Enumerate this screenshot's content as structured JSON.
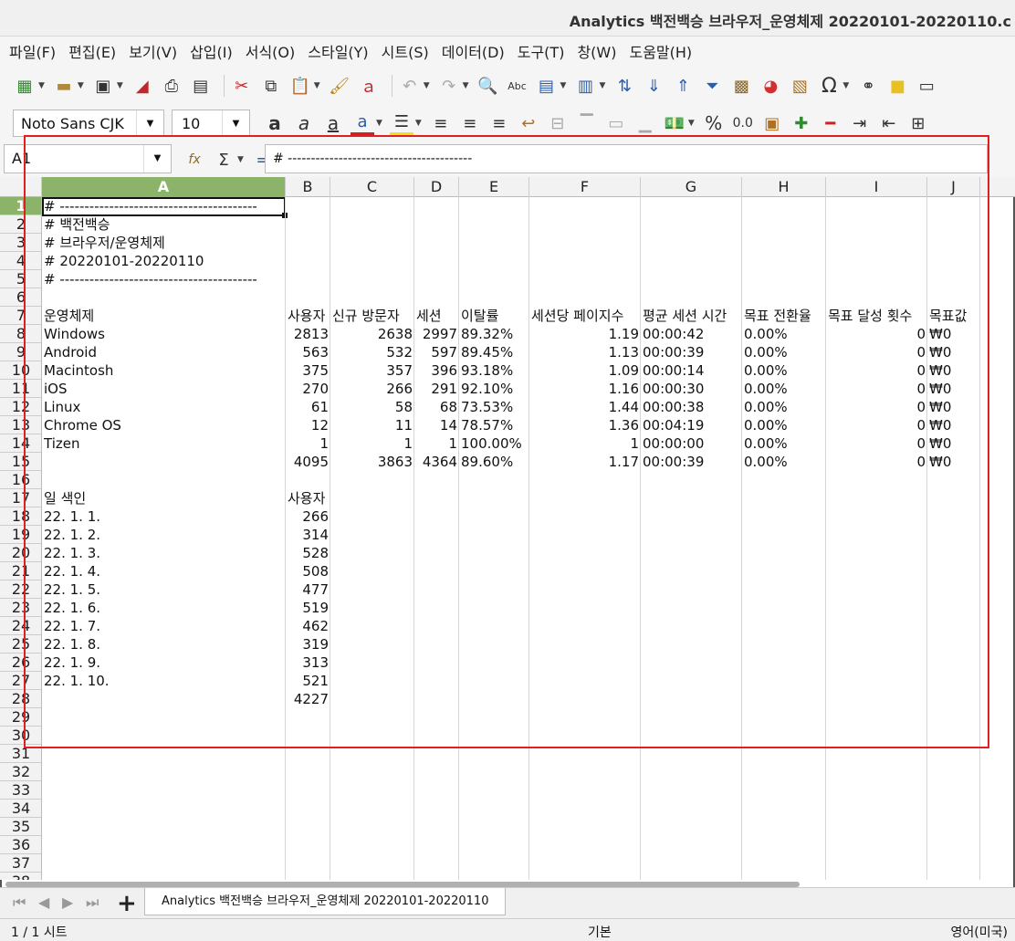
{
  "window": {
    "title": "Analytics 백전백승 브라우저_운영체제 20220101-20220110.c"
  },
  "menu": [
    "파일(F)",
    "편집(E)",
    "보기(V)",
    "삽입(I)",
    "서식(O)",
    "스타일(Y)",
    "시트(S)",
    "데이터(D)",
    "도구(T)",
    "창(W)",
    "도움말(H)"
  ],
  "toolbar": {
    "font_name": "Noto Sans CJK",
    "font_size": "10",
    "icons": [
      "new-icon",
      "open-icon",
      "save-icon",
      "export-pdf-icon",
      "print-icon",
      "print-preview-icon",
      "cut-icon",
      "copy-icon",
      "paste-icon",
      "clone-formatting-icon",
      "clear-formatting-icon",
      "undo-icon",
      "redo-icon",
      "find-replace-icon",
      "spelling-icon",
      "row-icon",
      "column-icon",
      "sort-icon",
      "sort-ascending-icon",
      "sort-descending-icon",
      "autofilter-icon",
      "image-icon",
      "chart-icon",
      "pivot-table-icon",
      "special-character-icon",
      "hyperlink-icon",
      "comment-icon",
      "header-footer-icon"
    ]
  },
  "formula_bar": {
    "name_box": "A1",
    "content": "# ----------------------------------------"
  },
  "columns": [
    "A",
    "B",
    "C",
    "D",
    "E",
    "F",
    "G",
    "H",
    "I",
    "J"
  ],
  "rows": [
    "1",
    "2",
    "3",
    "4",
    "5",
    "6",
    "7",
    "8",
    "9",
    "10",
    "11",
    "12",
    "13",
    "14",
    "15",
    "16",
    "17",
    "18",
    "19",
    "20",
    "21",
    "22",
    "23",
    "24",
    "25",
    "26",
    "27",
    "28",
    "29",
    "30",
    "31",
    "32",
    "33",
    "34",
    "35",
    "36",
    "37",
    "38"
  ],
  "sheet": {
    "meta": [
      "# ----------------------------------------",
      "# 백전백승",
      "# 브라우저/운영체제",
      "# 20220101-20220110",
      "# ----------------------------------------"
    ],
    "os_headers": [
      "운영체제",
      "사용자",
      "신규 방문자",
      "세션",
      "이탈률",
      "세션당 페이지수",
      "평균 세션 시간",
      "목표 전환율",
      "목표 달성 횟수",
      "목표값"
    ],
    "os_rows": [
      [
        "Windows",
        "2813",
        "2638",
        "2997",
        "89.32%",
        "1.19",
        "00:00:42",
        "0.00%",
        "0",
        "₩0"
      ],
      [
        "Android",
        "563",
        "532",
        "597",
        "89.45%",
        "1.13",
        "00:00:39",
        "0.00%",
        "0",
        "₩0"
      ],
      [
        "Macintosh",
        "375",
        "357",
        "396",
        "93.18%",
        "1.09",
        "00:00:14",
        "0.00%",
        "0",
        "₩0"
      ],
      [
        "iOS",
        "270",
        "266",
        "291",
        "92.10%",
        "1.16",
        "00:00:30",
        "0.00%",
        "0",
        "₩0"
      ],
      [
        "Linux",
        "61",
        "58",
        "68",
        "73.53%",
        "1.44",
        "00:00:38",
        "0.00%",
        "0",
        "₩0"
      ],
      [
        "Chrome OS",
        "12",
        "11",
        "14",
        "78.57%",
        "1.36",
        "00:04:19",
        "0.00%",
        "0",
        "₩0"
      ],
      [
        "Tizen",
        "1",
        "1",
        "1",
        "100.00%",
        "1",
        "00:00:00",
        "0.00%",
        "0",
        "₩0"
      ],
      [
        "",
        "4095",
        "3863",
        "4364",
        "89.60%",
        "1.17",
        "00:00:39",
        "0.00%",
        "0",
        "₩0"
      ]
    ],
    "day_headers": [
      "일 색인",
      "사용자"
    ],
    "day_rows": [
      [
        "22. 1. 1.",
        "266"
      ],
      [
        "22. 1. 2.",
        "314"
      ],
      [
        "22. 1. 3.",
        "528"
      ],
      [
        "22. 1. 4.",
        "508"
      ],
      [
        "22. 1. 5.",
        "477"
      ],
      [
        "22. 1. 6.",
        "519"
      ],
      [
        "22. 1. 7.",
        "462"
      ],
      [
        "22. 1. 8.",
        "319"
      ],
      [
        "22. 1. 9.",
        "313"
      ],
      [
        "22. 1. 10.",
        "521"
      ],
      [
        "",
        "4227"
      ]
    ]
  },
  "tabs": {
    "sheet_name": "Analytics 백전백승 브라우저_운영체제 20220101-20220110"
  },
  "status": {
    "sheet_count": "1 / 1 시트",
    "style": "기본",
    "language": "영어(미국)"
  },
  "colors": {
    "selection_header": "#8bb46a",
    "annotation_box": "#e02020"
  }
}
